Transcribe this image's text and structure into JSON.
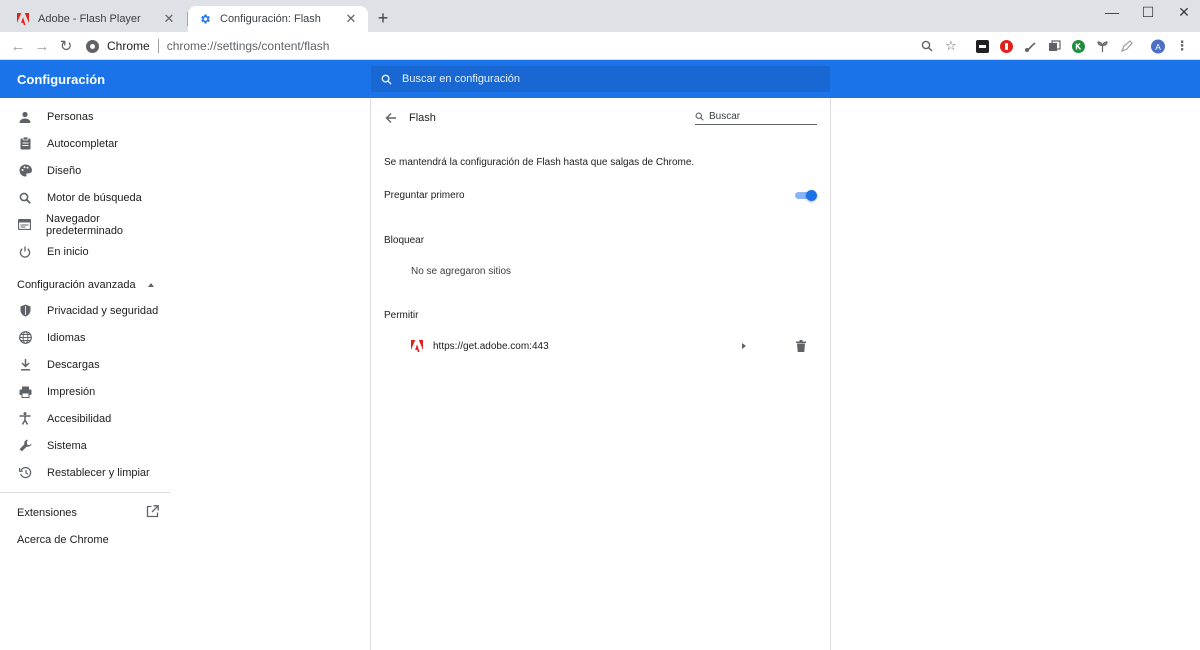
{
  "tabs": [
    {
      "title": "Adobe - Flash Player",
      "icon": "adobe-icon",
      "active": false
    },
    {
      "title": "Configuración: Flash",
      "icon": "gear-icon",
      "active": true
    }
  ],
  "toolbar": {
    "site_name": "Chrome",
    "url": "chrome://settings/content/flash"
  },
  "header": {
    "title": "Configuración",
    "search_placeholder": "Buscar en configuración"
  },
  "sidebar": {
    "items": [
      {
        "label": "Personas",
        "icon": "person-icon"
      },
      {
        "label": "Autocompletar",
        "icon": "clipboard-icon"
      },
      {
        "label": "Diseño",
        "icon": "palette-icon"
      },
      {
        "label": "Motor de búsqueda",
        "icon": "search-icon"
      },
      {
        "label": "Navegador predeterminado",
        "icon": "browser-icon"
      },
      {
        "label": "En inicio",
        "icon": "power-icon"
      }
    ],
    "advanced_label": "Configuración avanzada",
    "advanced_items": [
      {
        "label": "Privacidad y seguridad",
        "icon": "shield-icon"
      },
      {
        "label": "Idiomas",
        "icon": "globe-icon"
      },
      {
        "label": "Descargas",
        "icon": "download-icon"
      },
      {
        "label": "Impresión",
        "icon": "printer-icon"
      },
      {
        "label": "Accesibilidad",
        "icon": "accessibility-icon"
      },
      {
        "label": "Sistema",
        "icon": "wrench-icon"
      },
      {
        "label": "Restablecer y limpiar",
        "icon": "restore-icon"
      }
    ],
    "extensions_label": "Extensiones",
    "about_label": "Acerca de Chrome"
  },
  "main": {
    "title": "Flash",
    "search_placeholder": "Buscar",
    "info": "Se mantendrá la configuración de Flash hasta que salgas de Chrome.",
    "toggle_label": "Preguntar primero",
    "toggle_on": true,
    "block_label": "Bloquear",
    "block_empty": "No se agregaron sitios",
    "allow_label": "Permitir",
    "allowed_sites": [
      {
        "url": "https://get.adobe.com:443"
      }
    ]
  },
  "colors": {
    "accent": "#1a73e8",
    "adobe_red": "#e0201b"
  }
}
